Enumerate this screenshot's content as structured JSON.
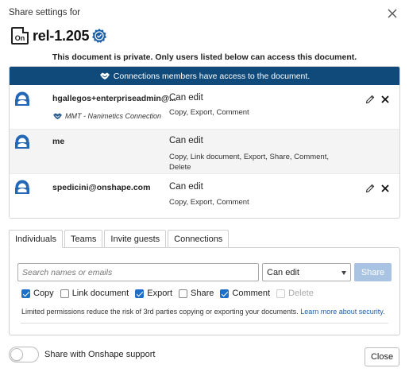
{
  "dialog": {
    "title": "Share settings for",
    "document_name": "rel-1.205",
    "doc_icon_text": "On",
    "privacy_message": "This document is private. Only users listed below can access this document."
  },
  "connections_banner": "Connections members have access to the document.",
  "users": [
    {
      "email": "hgallegos+enterpriseadmin@...",
      "connection": "MMT - Nanimetics Connection",
      "permission": "Can edit",
      "details": "Copy, Export, Comment"
    },
    {
      "email": "me",
      "permission": "Can edit",
      "details": "Copy, Link document, Export, Share, Comment, Delete"
    },
    {
      "email": "spedicini@onshape.com",
      "permission": "Can edit",
      "details": "Copy, Export, Comment"
    }
  ],
  "tabs": [
    "Individuals",
    "Teams",
    "Invite guests",
    "Connections"
  ],
  "active_tab": "Individuals",
  "invite": {
    "search_placeholder": "Search names or emails",
    "permission_selected": "Can edit",
    "share_label": "Share",
    "share_color": "#a9c3e2"
  },
  "checkboxes": [
    {
      "label": "Copy",
      "checked": true
    },
    {
      "label": "Link document",
      "checked": false
    },
    {
      "label": "Export",
      "checked": true
    },
    {
      "label": "Share",
      "checked": false
    },
    {
      "label": "Comment",
      "checked": true
    },
    {
      "label": "Delete",
      "checked": false,
      "disabled": true
    }
  ],
  "limit_note": "Limited permissions reduce the risk of 3rd parties copying or exporting your documents.",
  "learn_more": "Learn more about security.",
  "support_toggle": {
    "label": "Share with Onshape support",
    "on": false
  },
  "close_label": "Close",
  "colors": {
    "banner": "#0f4a7b",
    "accent": "#1d6fc7",
    "avatar": "#2467b5",
    "badge": "#1b5fa6"
  },
  "icons": [
    "close-icon",
    "doc-icon",
    "release-badge-icon",
    "handshake-icon",
    "avatar-icon",
    "pencil-icon",
    "remove-icon",
    "chevron-down-icon",
    "check-icon"
  ]
}
